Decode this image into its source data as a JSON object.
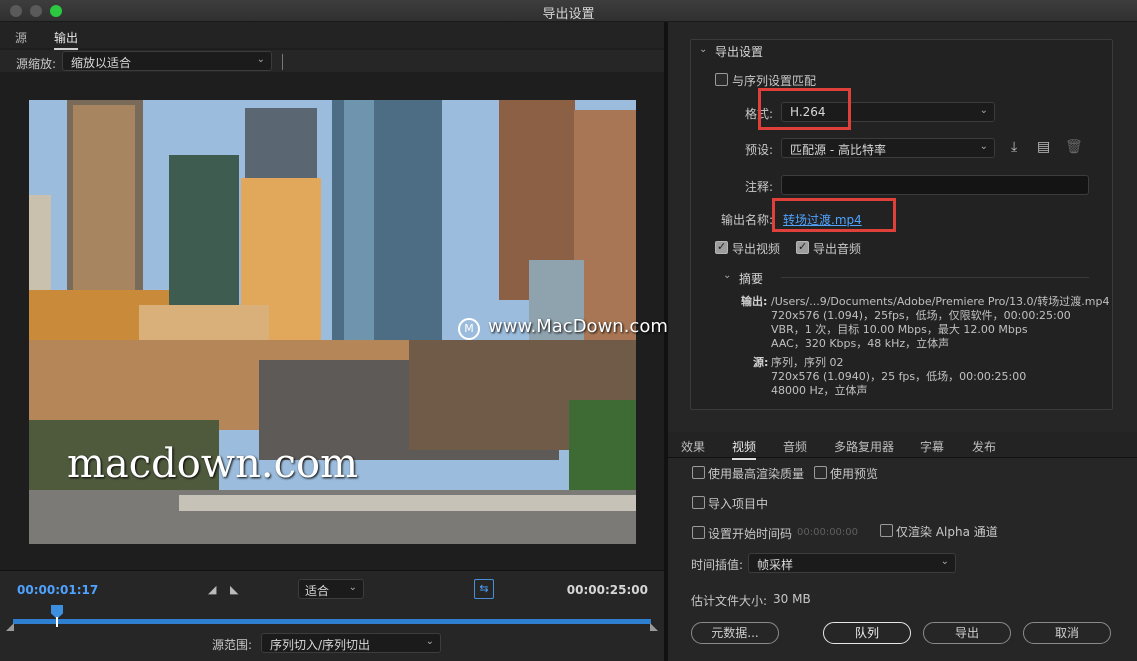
{
  "window": {
    "title": "导出设置"
  },
  "left": {
    "tabs": [
      {
        "label": "源",
        "active": false
      },
      {
        "label": "输出",
        "active": true
      }
    ],
    "source_zoom": {
      "label": "源缩放:",
      "value": "缩放以适合"
    },
    "preview_watermark": "macdown.com",
    "timeline": {
      "current_tc": "00:00:01:17",
      "end_tc": "00:00:25:00",
      "fit_value": "适合",
      "progress": 0.067,
      "source_range": {
        "label": "源范围:",
        "value": "序列切入/序列切出"
      }
    }
  },
  "export_settings": {
    "title": "导出设置",
    "match_sequence": {
      "label": "与序列设置匹配",
      "checked": false
    },
    "format": {
      "label": "格式:",
      "value": "H.264"
    },
    "preset": {
      "label": "预设:",
      "value": "匹配源 - 高比特率"
    },
    "comments": {
      "label": "注释:",
      "value": ""
    },
    "output_name": {
      "label": "输出名称:",
      "value": "转场过渡.mp4"
    },
    "export_video": {
      "label": "导出视频",
      "checked": true
    },
    "export_audio": {
      "label": "导出音频",
      "checked": true
    },
    "summary": {
      "title": "摘要",
      "output_label": "输出:",
      "output_lines": [
        "/Users/...9/Documents/Adobe/Premiere Pro/13.0/转场过渡.mp4",
        "720x576 (1.094)，25fps，低场，仅限软件，00:00:25:00",
        "VBR，1 次，目标 10.00 Mbps，最大 12.00 Mbps",
        "AAC，320 Kbps，48  kHz，立体声"
      ],
      "source_label": "源:",
      "source_lines": [
        "序列，序列 02",
        "720x576 (1.0940)，25 fps，低场，00:00:25:00",
        "48000 Hz，立体声"
      ]
    }
  },
  "watermark": {
    "text": "www.MacDown.com",
    "logo": "M"
  },
  "subtabs": [
    {
      "label": "效果",
      "active": false
    },
    {
      "label": "视频",
      "active": true
    },
    {
      "label": "音频",
      "active": false
    },
    {
      "label": "多路复用器",
      "active": false
    },
    {
      "label": "字幕",
      "active": false
    },
    {
      "label": "发布",
      "active": false
    }
  ],
  "options": {
    "max_render_quality": {
      "label": "使用最高渲染质量",
      "checked": false
    },
    "use_previews": {
      "label": "使用预览",
      "checked": false
    },
    "import_into_project": {
      "label": "导入项目中",
      "checked": false
    },
    "set_start_tc": {
      "label": "设置开始时间码",
      "checked": false,
      "value": "00:00:00:00"
    },
    "alpha_only": {
      "label": "仅渲染 Alpha 通道",
      "checked": false
    },
    "time_interpolation": {
      "label": "时间插值:",
      "value": "帧采样"
    },
    "est_file_size": {
      "label": "估计文件大小:",
      "value": "30 MB"
    }
  },
  "buttons": {
    "metadata": "元数据...",
    "queue": "队列",
    "export": "导出",
    "cancel": "取消"
  }
}
